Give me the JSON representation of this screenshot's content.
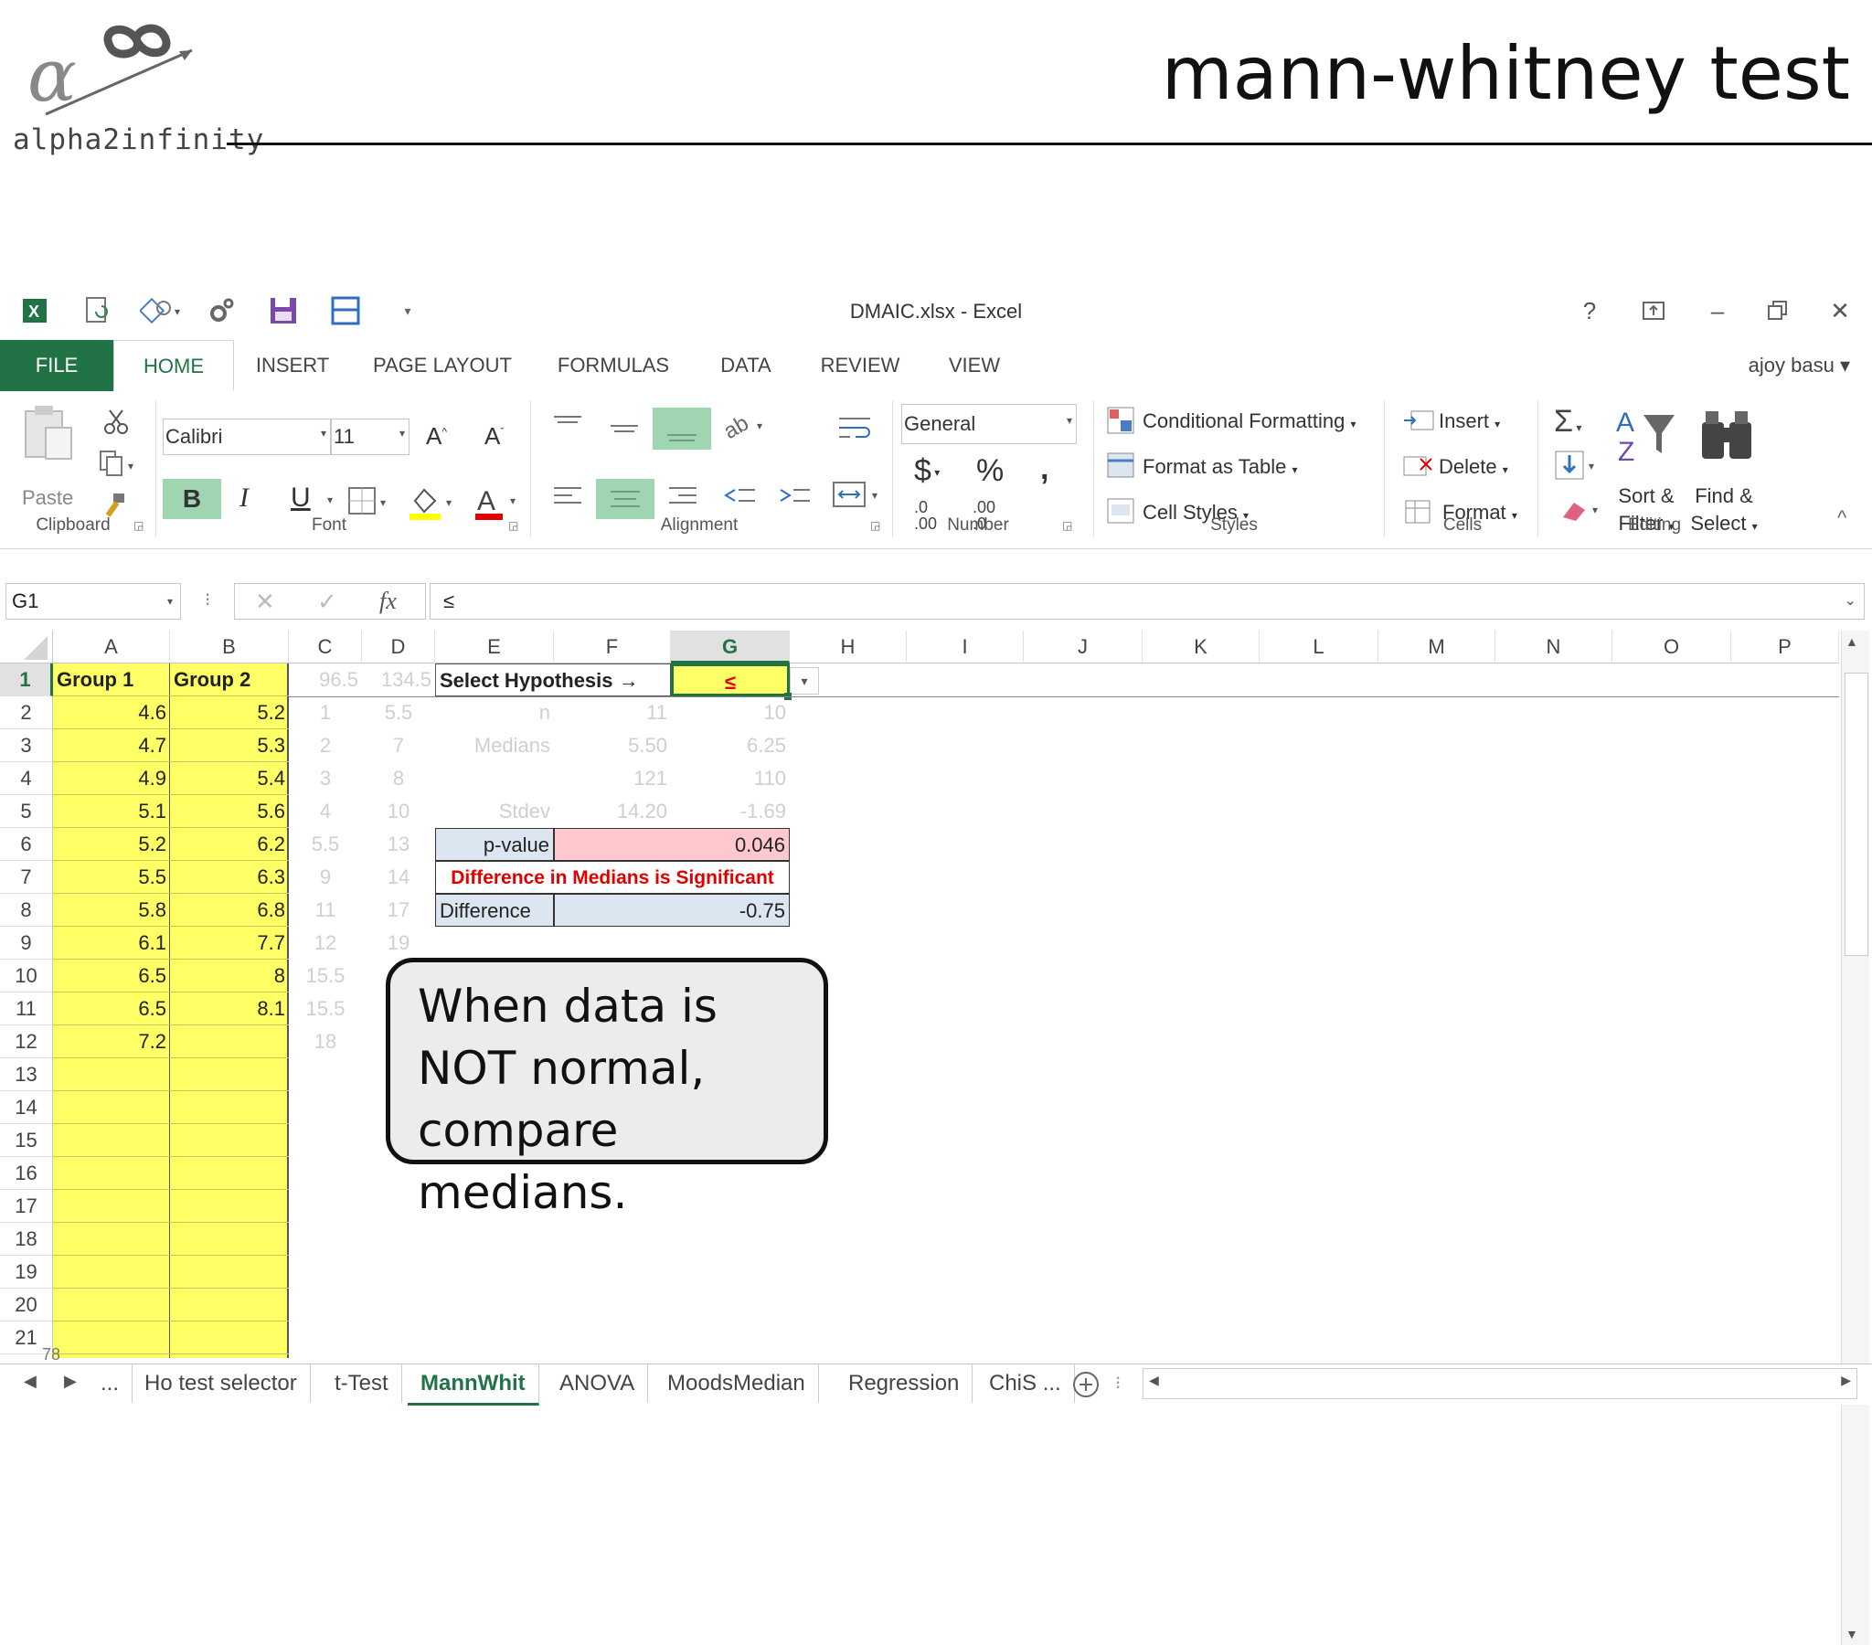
{
  "slide": {
    "title": "mann-whitney test",
    "logo_text": "alpha2infinity"
  },
  "window": {
    "title": "DMAIC.xlsx - Excel",
    "help": "?",
    "user": "ajoy basu"
  },
  "tabs": [
    "FILE",
    "HOME",
    "INSERT",
    "PAGE LAYOUT",
    "FORMULAS",
    "DATA",
    "REVIEW",
    "VIEW"
  ],
  "ribbon": {
    "clipboard": {
      "paste": "Paste",
      "label": "Clipboard"
    },
    "font": {
      "name": "Calibri",
      "size": "11",
      "bold": "B",
      "italic": "I",
      "underline": "U",
      "label": "Font"
    },
    "alignment": {
      "label": "Alignment"
    },
    "number": {
      "format": "General",
      "currency": "$",
      "percent": "%",
      "comma": ",",
      "inc_dec": ".0\n.00",
      "dec_dec": ".00\n.0",
      "label": "Number"
    },
    "styles": {
      "conditional": "Conditional Formatting",
      "table": "Format as Table",
      "cell": "Cell Styles",
      "label": "Styles"
    },
    "cells": {
      "insert": "Insert",
      "delete": "Delete",
      "format": "Format",
      "label": "Cells"
    },
    "editing": {
      "sort": "Sort &",
      "filter": "Filter",
      "find": "Find &",
      "select": "Select",
      "label": "Editing"
    }
  },
  "formula_bar": {
    "name_box": "G1",
    "fx": "fx",
    "value": "≤"
  },
  "columns": [
    "A",
    "B",
    "C",
    "D",
    "E",
    "F",
    "G",
    "H",
    "I",
    "J",
    "K",
    "L",
    "M",
    "N",
    "O",
    "P"
  ],
  "rows": [
    "1",
    "2",
    "3",
    "4",
    "5",
    "6",
    "7",
    "8",
    "9",
    "10",
    "11",
    "12",
    "13",
    "14",
    "15",
    "16",
    "17",
    "18",
    "19",
    "20",
    "21"
  ],
  "sheet": {
    "A1": "Group 1",
    "B1": "Group 2",
    "C1": "96.5",
    "D1": "134.5",
    "E1": "Select Hypothesis →",
    "G1": "≤",
    "group1": [
      "4.6",
      "4.7",
      "4.9",
      "5.1",
      "5.2",
      "5.5",
      "5.8",
      "6.1",
      "6.5",
      "6.5",
      "7.2"
    ],
    "group2": [
      "5.2",
      "5.3",
      "5.4",
      "5.6",
      "6.2",
      "6.3",
      "6.8",
      "7.7",
      "8",
      "8.1"
    ],
    "colC": [
      "1",
      "2",
      "3",
      "4",
      "5.5",
      "9",
      "11",
      "12",
      "15.5",
      "15.5",
      "18"
    ],
    "colD": [
      "5.5",
      "7",
      "8",
      "10",
      "13",
      "14",
      "17",
      "19"
    ],
    "stats": {
      "n_label": "n",
      "n_f": "11",
      "n_g": "10",
      "med_label": "Medians",
      "med_f": "5.50",
      "med_g": "6.25",
      "r4_f": "121",
      "r4_g": "110",
      "sd_label": "Stdev",
      "sd_f": "14.20",
      "sd_g": "-1.69"
    },
    "pvalue_label": "p-value",
    "pvalue": "0.046",
    "significance": "Difference in Medians is Significant",
    "diff_label": "Difference",
    "diff": "-0.75",
    "footnote": "78"
  },
  "callout": "When data is NOT normal, compare medians.",
  "sheet_tabs": [
    "...",
    "Ho test selector",
    "t-Test",
    "MannWhit",
    "ANOVA",
    "MoodsMedian",
    "Regression",
    "ChiS ..."
  ],
  "colors": {
    "excel_green": "#217346",
    "highlight_yellow": "#ffff66",
    "pvalue_pink": "#ffc7ce",
    "label_blue": "#dce6f1",
    "alert_red": "#e00000"
  }
}
